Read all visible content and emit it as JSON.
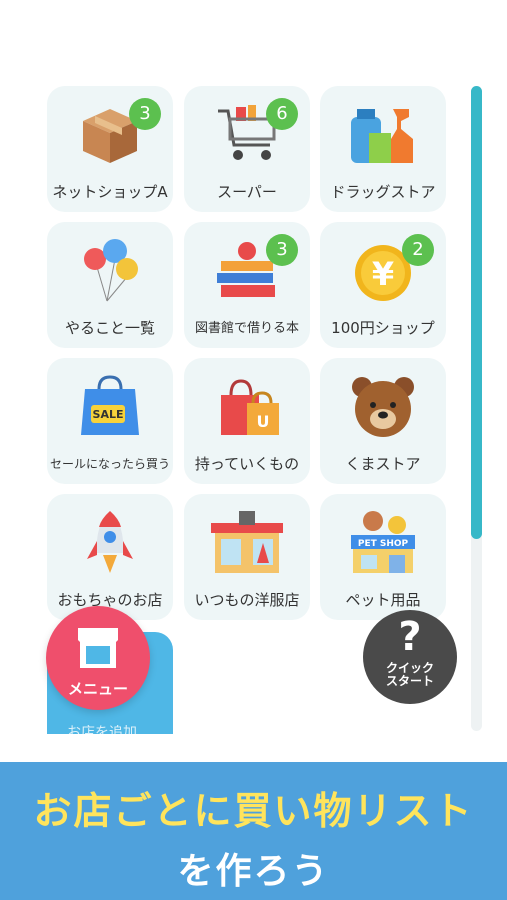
{
  "tiles": [
    {
      "label": "ネットショップA",
      "badge": "3"
    },
    {
      "label": "スーパー",
      "badge": "6"
    },
    {
      "label": "ドラッグストア",
      "badge": ""
    },
    {
      "label": "やること一覧",
      "badge": ""
    },
    {
      "label": "図書館で借りる本",
      "badge": "3"
    },
    {
      "label": "100円ショップ",
      "badge": "2"
    },
    {
      "label": "セールになったら買う",
      "badge": ""
    },
    {
      "label": "持っていくもの",
      "badge": ""
    },
    {
      "label": "くまストア",
      "badge": ""
    },
    {
      "label": "おもちゃのお店",
      "badge": ""
    },
    {
      "label": "いつもの洋服店",
      "badge": ""
    },
    {
      "label": "ペット用品",
      "badge": ""
    }
  ],
  "icon_text": {
    "sale": "SALE",
    "pet_shop": "PET SHOP",
    "yen": "¥",
    "bag_letter": "U"
  },
  "add_tile": {
    "label": "お店を追加"
  },
  "menu_button": {
    "label": "メニュー"
  },
  "quick_start": {
    "label": "クイック\nスタート",
    "glyph": "?"
  },
  "banner": {
    "line1": "お店ごとに買い物リスト",
    "line2": "を作ろう"
  },
  "colors": {
    "badge": "#5cc04f",
    "accent": "#37b8c8",
    "menu": "#ef4f6c",
    "banner": "#4fa1dc",
    "banner_text": "#ffe45c"
  }
}
